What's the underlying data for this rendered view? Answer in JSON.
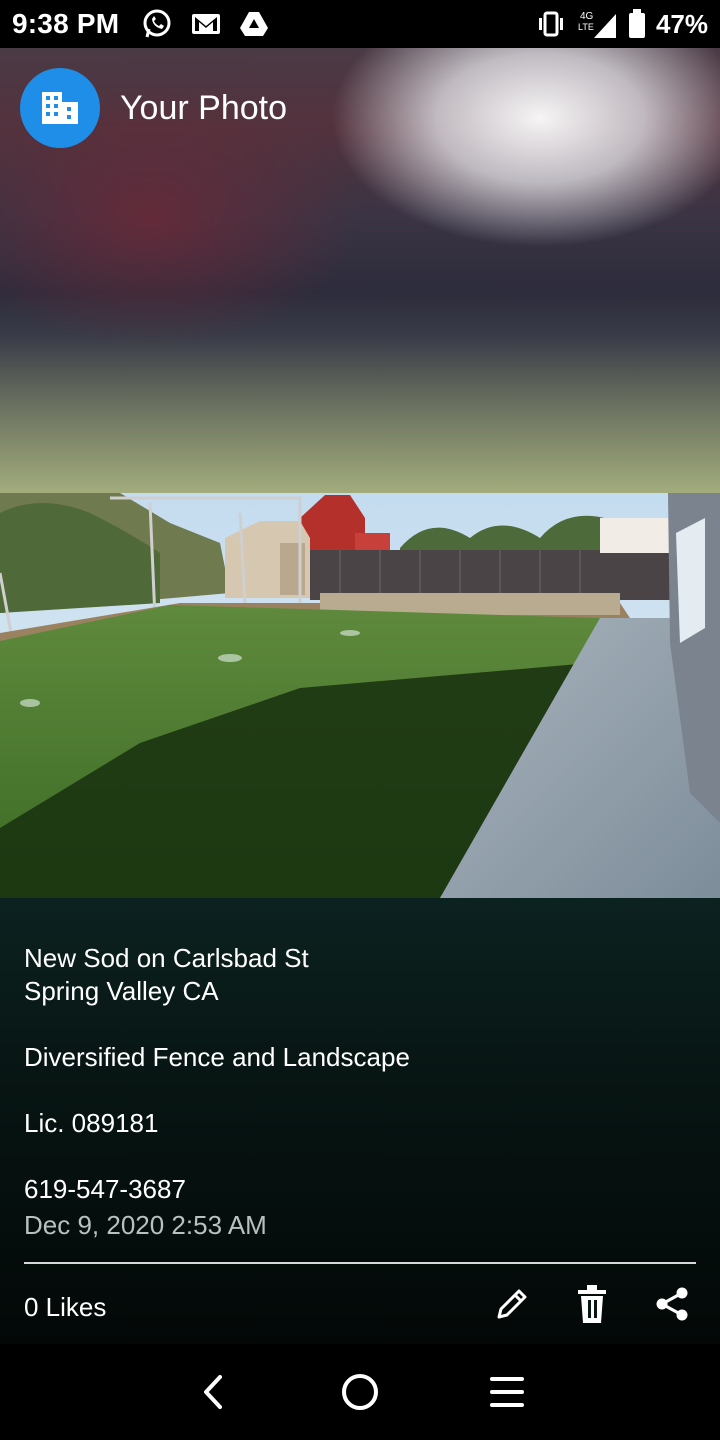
{
  "status_bar": {
    "time": "9:38 PM",
    "network_label": "4G LTE",
    "battery": "47%",
    "icons": [
      "whatsapp-icon",
      "gmail-icon",
      "drive-icon",
      "vibrate-icon",
      "signal-icon",
      "battery-icon"
    ]
  },
  "header": {
    "title": "Your Photo",
    "avatar_icon": "building-icon",
    "avatar_color": "#1e8ee8"
  },
  "post": {
    "caption_lines": [
      "New Sod on Carlsbad St",
      "Spring Valley CA",
      "",
      "Diversified Fence and Landscape",
      "",
      "Lic. 089181",
      "",
      "619-547-3687"
    ],
    "timestamp": "Dec 9, 2020 2:53 AM",
    "likes": "0 Likes",
    "actions": [
      "edit-icon",
      "delete-icon",
      "share-icon"
    ]
  },
  "nav_bar": {
    "buttons": [
      "back-icon",
      "home-icon",
      "menu-icon"
    ]
  }
}
